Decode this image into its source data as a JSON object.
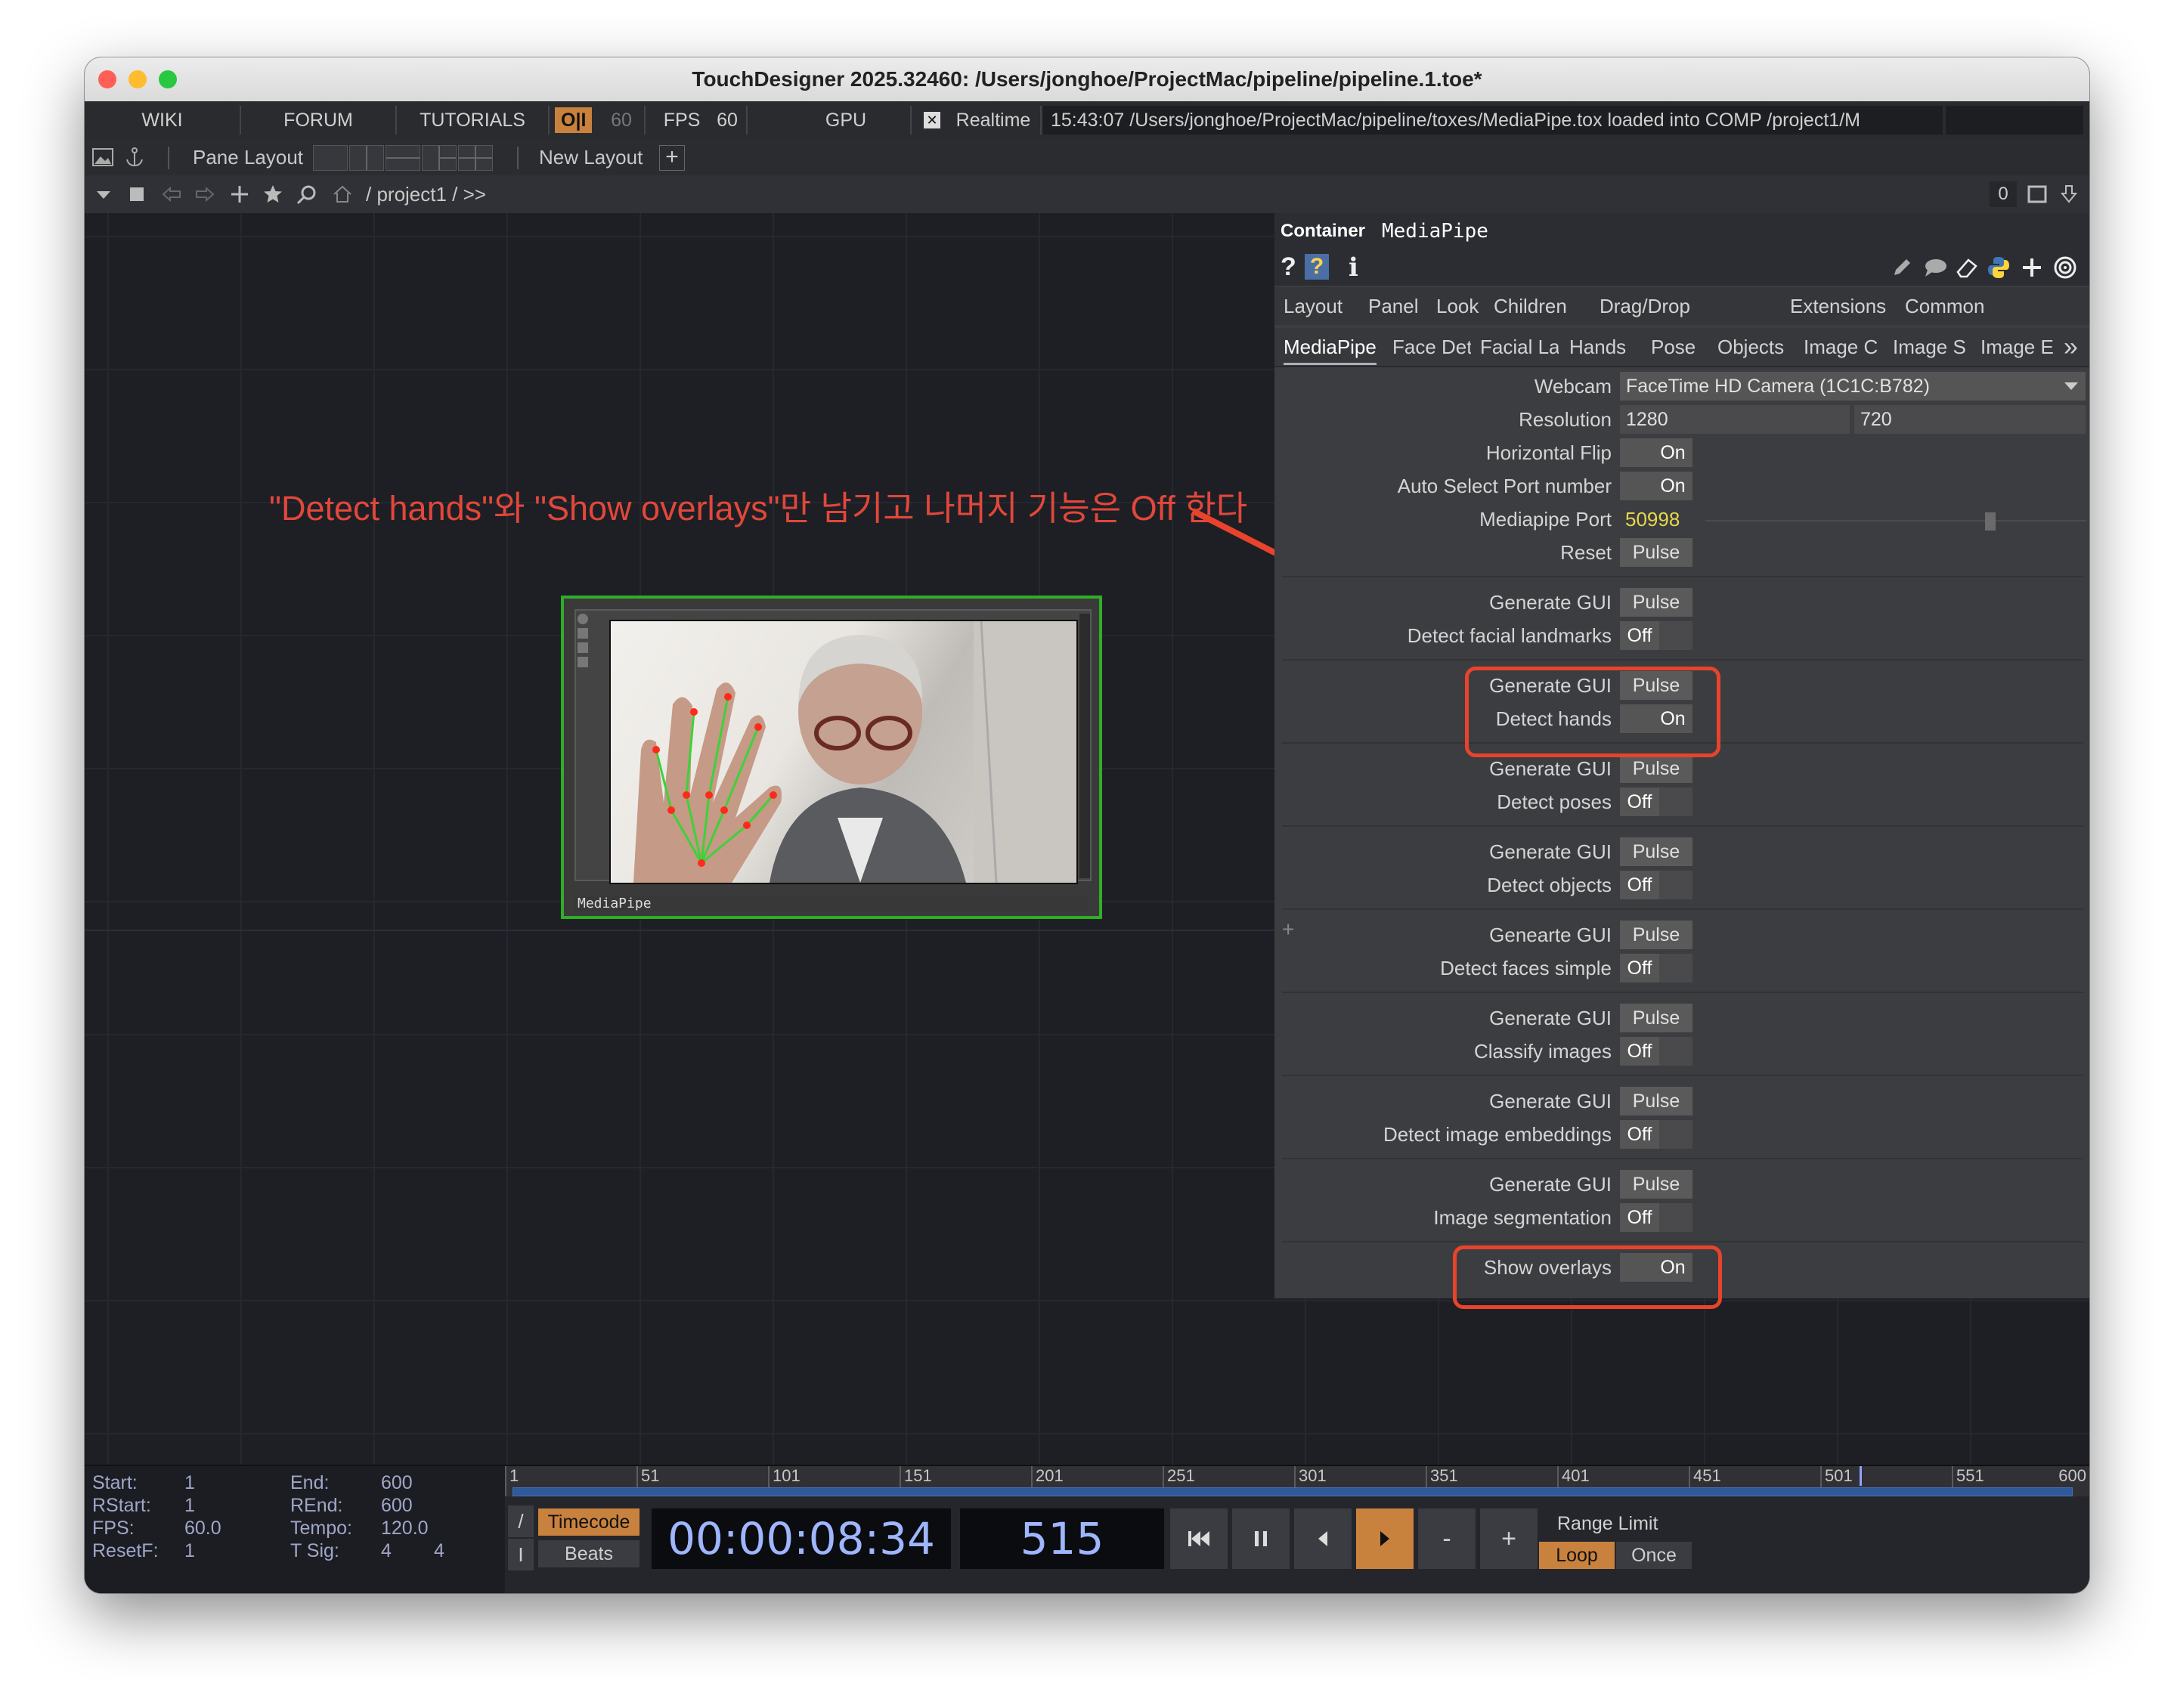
{
  "window": {
    "title": "TouchDesigner 2025.32460: /Users/jonghoe/ProjectMac/pipeline/pipeline.1.toe*"
  },
  "toolbar1": {
    "wiki": "WIKI",
    "forum": "FORUM",
    "tutorials": "TUTORIALS",
    "oi_badge": "O|I",
    "oi_value": "60",
    "fps_label": "FPS",
    "fps_value": "60",
    "gpu": "GPU",
    "realtime_check": "✕",
    "realtime": "Realtime",
    "status": "15:43:07 /Users/jonghoe/ProjectMac/pipeline/toxes/MediaPipe.tox loaded into COMP /project1/M"
  },
  "toolbar2": {
    "pane_layout": "Pane Layout",
    "new_layout": "New Layout",
    "plus": "+"
  },
  "toolbar3": {
    "path": "/ project1 / >>",
    "counter": "0"
  },
  "annotation": {
    "text": "\"Detect hands\"와 \"Show overlays\"만 남기고 나머지 기능은 Off 한다",
    "color": "#e2473a"
  },
  "node": {
    "label": "MediaPipe"
  },
  "param_panel": {
    "type": "Container",
    "name": "MediaPipe",
    "icons": [
      "help-icon",
      "python-help-icon",
      "info-icon",
      "edit-icon",
      "comment-icon",
      "eraser-icon",
      "python-icon",
      "plus-icon",
      "target-icon"
    ],
    "tabs1": [
      "Layout",
      "Panel",
      "Look",
      "Children",
      "Drag/Drop",
      "Extensions",
      "Common"
    ],
    "tabs2": [
      "MediaPipe",
      "Face Det",
      "Facial La",
      "Hands",
      "Pose",
      "Objects",
      "Image C",
      "Image S",
      "Image E"
    ],
    "more": "»",
    "webcam": {
      "label": "Webcam",
      "value": "FaceTime HD Camera (1C1C:B782)"
    },
    "resolution": {
      "label": "Resolution",
      "w": "1280",
      "h": "720"
    },
    "hflip": {
      "label": "Horizontal Flip",
      "value": "On"
    },
    "autoport": {
      "label": "Auto Select Port number",
      "value": "On"
    },
    "port": {
      "label": "Mediapipe Port",
      "value": "50998"
    },
    "reset": {
      "label": "Reset",
      "value": "Pulse"
    },
    "groups": [
      {
        "gen": "Generate GUI",
        "pulse": "Pulse",
        "label": "Detect facial landmarks",
        "value": "Off"
      },
      {
        "gen": "Generate GUI",
        "pulse": "Pulse",
        "label": "Detect hands",
        "value": "On"
      },
      {
        "gen": "Generate GUI",
        "pulse": "Pulse",
        "label": "Detect poses",
        "value": "Off"
      },
      {
        "gen": "Generate GUI",
        "pulse": "Pulse",
        "label": "Detect objects",
        "value": "Off"
      },
      {
        "gen": "Genearte GUI",
        "pulse": "Pulse",
        "label": "Detect faces simple",
        "value": "Off"
      },
      {
        "gen": "Generate GUI",
        "pulse": "Pulse",
        "label": "Classify images",
        "value": "Off"
      },
      {
        "gen": "Generate GUI",
        "pulse": "Pulse",
        "label": "Detect image embeddings",
        "value": "Off"
      },
      {
        "gen": "Generate GUI",
        "pulse": "Pulse",
        "label": "Image segmentation",
        "value": "Off"
      }
    ],
    "overlays": {
      "label": "Show overlays",
      "value": "On"
    },
    "margin_plus": "+"
  },
  "timeline": {
    "start_label": "Start:",
    "start": "1",
    "end_label": "End:",
    "end": "600",
    "rstart_label": "RStart:",
    "rstart": "1",
    "rend_label": "REnd:",
    "rend": "600",
    "fps_label": "FPS:",
    "fps": "60.0",
    "tempo_label": "Tempo:",
    "tempo": "120.0",
    "resetf_label": "ResetF:",
    "resetf": "1",
    "tsig_label": "T Sig:",
    "tsig_a": "4",
    "tsig_b": "4",
    "ticks": [
      "1",
      "51",
      "101",
      "151",
      "201",
      "251",
      "301",
      "351",
      "401",
      "451",
      "501",
      "551",
      "600"
    ],
    "slash": "/",
    "ibeam": "I",
    "timecode_btn": "Timecode",
    "beats_btn": "Beats",
    "timecode": "00:00:08:34",
    "frame": "515",
    "minus": "-",
    "plus": "+",
    "range_limit": "Range Limit",
    "loop": "Loop",
    "once": "Once"
  }
}
